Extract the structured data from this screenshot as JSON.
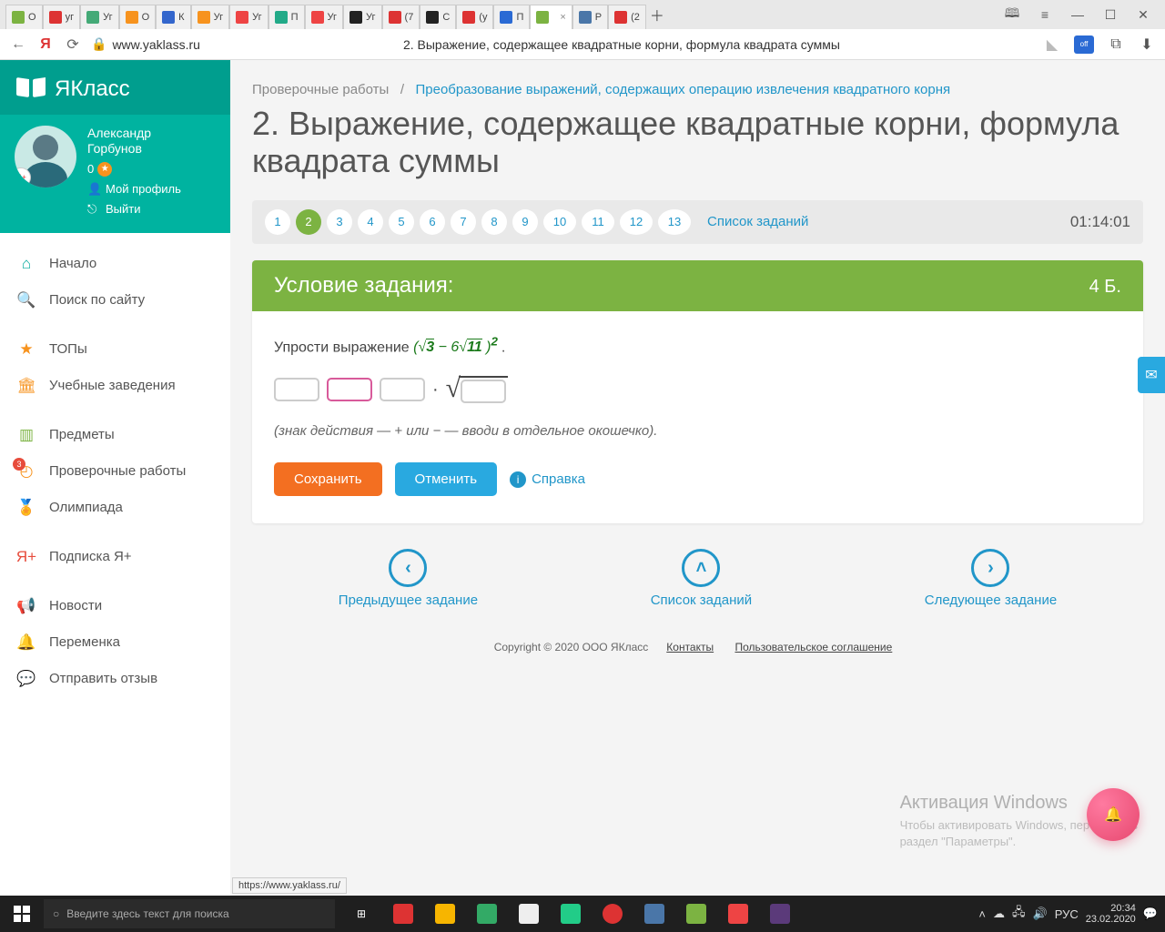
{
  "browser": {
    "tabs": [
      {
        "label": "O",
        "color": "#7cb342"
      },
      {
        "label": "уг",
        "color": "#d33"
      },
      {
        "label": "Уг",
        "color": "#4a7"
      },
      {
        "label": "O",
        "color": "#f7931e"
      },
      {
        "label": "К",
        "color": "#36c"
      },
      {
        "label": "Уг",
        "color": "#f7931e"
      },
      {
        "label": "Уг",
        "color": "#e44"
      },
      {
        "label": "П",
        "color": "#2a8"
      },
      {
        "label": "Уг",
        "color": "#e44"
      },
      {
        "label": "Уг",
        "color": "#222"
      },
      {
        "label": "(7",
        "color": "#d33"
      },
      {
        "label": "С",
        "color": "#222"
      },
      {
        "label": "(у",
        "color": "#d33"
      },
      {
        "label": "П",
        "color": "#2a6ad4"
      },
      {
        "label": "",
        "color": "#7cb342",
        "active": true
      },
      {
        "label": "Р",
        "color": "#4a76a8"
      },
      {
        "label": "(2",
        "color": "#d33"
      }
    ],
    "url_host": "www.yaklass.ru",
    "page_title": "2. Выражение, содержащее квадратные корни, формула квадрата суммы"
  },
  "sidebar": {
    "logo": "ЯКласс",
    "user": {
      "name1": "Александр",
      "name2": "Горбунов",
      "score": "0",
      "profile": "Мой профиль",
      "logout": "Выйти",
      "ya": "Я+"
    },
    "nav": [
      {
        "icon": "⌂",
        "color": "c-teal",
        "label": "Начало"
      },
      {
        "icon": "🔍",
        "color": "c-teal",
        "label": "Поиск по сайту"
      },
      {
        "sep": true
      },
      {
        "icon": "★",
        "color": "c-orange",
        "label": "ТОПы"
      },
      {
        "icon": "🏛",
        "color": "c-orange",
        "label": "Учебные заведения"
      },
      {
        "sep": true
      },
      {
        "icon": "▥",
        "color": "c-green",
        "label": "Предметы"
      },
      {
        "icon": "◴",
        "color": "c-orange",
        "label": "Проверочные работы",
        "badge": "3"
      },
      {
        "icon": "🏅",
        "color": "c-green",
        "label": "Олимпиада"
      },
      {
        "sep": true
      },
      {
        "icon": "Я+",
        "color": "c-red",
        "label": "Подписка Я+"
      },
      {
        "sep": true
      },
      {
        "icon": "📢",
        "color": "c-grey",
        "label": "Новости"
      },
      {
        "icon": "🔔",
        "color": "c-grey",
        "label": "Переменка"
      },
      {
        "icon": "💬",
        "color": "c-grey",
        "label": "Отправить отзыв"
      }
    ]
  },
  "main": {
    "breadcrumb": {
      "parent": "Проверочные работы",
      "sep": "/",
      "link": "Преобразование выражений, содержащих операцию извлечения квадратного корня"
    },
    "title": "2. Выражение, содержащее квадратные корни, формула квадрата суммы",
    "steps": [
      "1",
      "2",
      "3",
      "4",
      "5",
      "6",
      "7",
      "8",
      "9",
      "10",
      "11",
      "12",
      "13"
    ],
    "active_step": "2",
    "list_link": "Список заданий",
    "timer": "01:14:01",
    "card": {
      "head": "Условие задания:",
      "points": "4 Б.",
      "prompt_pre": "Упрости выражение ",
      "expr_open": "(",
      "expr_a": "3",
      "expr_minus": " − 6",
      "expr_b": "11",
      "expr_close": " )",
      "expr_pow": "2",
      "hint": "(знак действия — + или − — вводи в отдельное окошечко).",
      "save": "Сохранить",
      "cancel": "Отменить",
      "help": "Справка"
    },
    "bottomnav": {
      "prev": "Предыдущее задание",
      "list": "Список заданий",
      "next": "Следующее задание"
    },
    "footer": {
      "copy": "Copyright © 2020 ООО ЯКласс",
      "contacts": "Контакты",
      "terms": "Пользовательское соглашение"
    },
    "watermark": {
      "title": "Активация Windows",
      "sub1": "Чтобы активировать Windows, перейдите в",
      "sub2": "раздел \"Параметры\"."
    },
    "status_url": "https://www.yaklass.ru/"
  },
  "taskbar": {
    "search_placeholder": "Введите здесь текст для поиска",
    "lang": "РУС",
    "time": "20:34",
    "date": "23.02.2020"
  }
}
